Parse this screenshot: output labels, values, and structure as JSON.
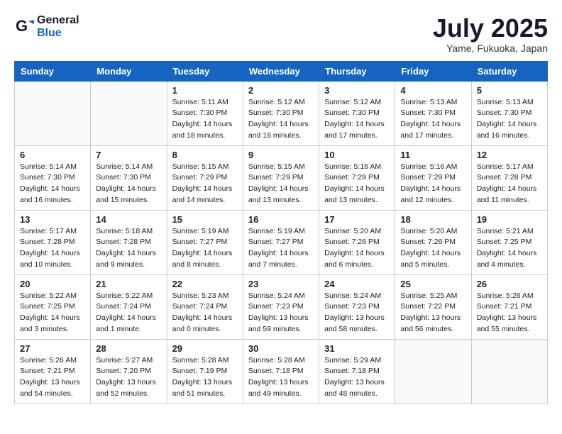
{
  "logo": {
    "general": "General",
    "blue": "Blue"
  },
  "header": {
    "month": "July 2025",
    "location": "Yame, Fukuoka, Japan"
  },
  "weekdays": [
    "Sunday",
    "Monday",
    "Tuesday",
    "Wednesday",
    "Thursday",
    "Friday",
    "Saturday"
  ],
  "weeks": [
    [
      {
        "day": "",
        "empty": true
      },
      {
        "day": "",
        "empty": true
      },
      {
        "day": "1",
        "sunrise": "Sunrise: 5:11 AM",
        "sunset": "Sunset: 7:30 PM",
        "daylight": "Daylight: 14 hours and 18 minutes."
      },
      {
        "day": "2",
        "sunrise": "Sunrise: 5:12 AM",
        "sunset": "Sunset: 7:30 PM",
        "daylight": "Daylight: 14 hours and 18 minutes."
      },
      {
        "day": "3",
        "sunrise": "Sunrise: 5:12 AM",
        "sunset": "Sunset: 7:30 PM",
        "daylight": "Daylight: 14 hours and 17 minutes."
      },
      {
        "day": "4",
        "sunrise": "Sunrise: 5:13 AM",
        "sunset": "Sunset: 7:30 PM",
        "daylight": "Daylight: 14 hours and 17 minutes."
      },
      {
        "day": "5",
        "sunrise": "Sunrise: 5:13 AM",
        "sunset": "Sunset: 7:30 PM",
        "daylight": "Daylight: 14 hours and 16 minutes."
      }
    ],
    [
      {
        "day": "6",
        "sunrise": "Sunrise: 5:14 AM",
        "sunset": "Sunset: 7:30 PM",
        "daylight": "Daylight: 14 hours and 16 minutes."
      },
      {
        "day": "7",
        "sunrise": "Sunrise: 5:14 AM",
        "sunset": "Sunset: 7:30 PM",
        "daylight": "Daylight: 14 hours and 15 minutes."
      },
      {
        "day": "8",
        "sunrise": "Sunrise: 5:15 AM",
        "sunset": "Sunset: 7:29 PM",
        "daylight": "Daylight: 14 hours and 14 minutes."
      },
      {
        "day": "9",
        "sunrise": "Sunrise: 5:15 AM",
        "sunset": "Sunset: 7:29 PM",
        "daylight": "Daylight: 14 hours and 13 minutes."
      },
      {
        "day": "10",
        "sunrise": "Sunrise: 5:16 AM",
        "sunset": "Sunset: 7:29 PM",
        "daylight": "Daylight: 14 hours and 13 minutes."
      },
      {
        "day": "11",
        "sunrise": "Sunrise: 5:16 AM",
        "sunset": "Sunset: 7:29 PM",
        "daylight": "Daylight: 14 hours and 12 minutes."
      },
      {
        "day": "12",
        "sunrise": "Sunrise: 5:17 AM",
        "sunset": "Sunset: 7:28 PM",
        "daylight": "Daylight: 14 hours and 11 minutes."
      }
    ],
    [
      {
        "day": "13",
        "sunrise": "Sunrise: 5:17 AM",
        "sunset": "Sunset: 7:28 PM",
        "daylight": "Daylight: 14 hours and 10 minutes."
      },
      {
        "day": "14",
        "sunrise": "Sunrise: 5:18 AM",
        "sunset": "Sunset: 7:28 PM",
        "daylight": "Daylight: 14 hours and 9 minutes."
      },
      {
        "day": "15",
        "sunrise": "Sunrise: 5:19 AM",
        "sunset": "Sunset: 7:27 PM",
        "daylight": "Daylight: 14 hours and 8 minutes."
      },
      {
        "day": "16",
        "sunrise": "Sunrise: 5:19 AM",
        "sunset": "Sunset: 7:27 PM",
        "daylight": "Daylight: 14 hours and 7 minutes."
      },
      {
        "day": "17",
        "sunrise": "Sunrise: 5:20 AM",
        "sunset": "Sunset: 7:26 PM",
        "daylight": "Daylight: 14 hours and 6 minutes."
      },
      {
        "day": "18",
        "sunrise": "Sunrise: 5:20 AM",
        "sunset": "Sunset: 7:26 PM",
        "daylight": "Daylight: 14 hours and 5 minutes."
      },
      {
        "day": "19",
        "sunrise": "Sunrise: 5:21 AM",
        "sunset": "Sunset: 7:25 PM",
        "daylight": "Daylight: 14 hours and 4 minutes."
      }
    ],
    [
      {
        "day": "20",
        "sunrise": "Sunrise: 5:22 AM",
        "sunset": "Sunset: 7:25 PM",
        "daylight": "Daylight: 14 hours and 3 minutes."
      },
      {
        "day": "21",
        "sunrise": "Sunrise: 5:22 AM",
        "sunset": "Sunset: 7:24 PM",
        "daylight": "Daylight: 14 hours and 1 minute."
      },
      {
        "day": "22",
        "sunrise": "Sunrise: 5:23 AM",
        "sunset": "Sunset: 7:24 PM",
        "daylight": "Daylight: 14 hours and 0 minutes."
      },
      {
        "day": "23",
        "sunrise": "Sunrise: 5:24 AM",
        "sunset": "Sunset: 7:23 PM",
        "daylight": "Daylight: 13 hours and 59 minutes."
      },
      {
        "day": "24",
        "sunrise": "Sunrise: 5:24 AM",
        "sunset": "Sunset: 7:23 PM",
        "daylight": "Daylight: 13 hours and 58 minutes."
      },
      {
        "day": "25",
        "sunrise": "Sunrise: 5:25 AM",
        "sunset": "Sunset: 7:22 PM",
        "daylight": "Daylight: 13 hours and 56 minutes."
      },
      {
        "day": "26",
        "sunrise": "Sunrise: 5:26 AM",
        "sunset": "Sunset: 7:21 PM",
        "daylight": "Daylight: 13 hours and 55 minutes."
      }
    ],
    [
      {
        "day": "27",
        "sunrise": "Sunrise: 5:26 AM",
        "sunset": "Sunset: 7:21 PM",
        "daylight": "Daylight: 13 hours and 54 minutes."
      },
      {
        "day": "28",
        "sunrise": "Sunrise: 5:27 AM",
        "sunset": "Sunset: 7:20 PM",
        "daylight": "Daylight: 13 hours and 52 minutes."
      },
      {
        "day": "29",
        "sunrise": "Sunrise: 5:28 AM",
        "sunset": "Sunset: 7:19 PM",
        "daylight": "Daylight: 13 hours and 51 minutes."
      },
      {
        "day": "30",
        "sunrise": "Sunrise: 5:28 AM",
        "sunset": "Sunset: 7:18 PM",
        "daylight": "Daylight: 13 hours and 49 minutes."
      },
      {
        "day": "31",
        "sunrise": "Sunrise: 5:29 AM",
        "sunset": "Sunset: 7:18 PM",
        "daylight": "Daylight: 13 hours and 48 minutes."
      },
      {
        "day": "",
        "empty": true
      },
      {
        "day": "",
        "empty": true
      }
    ]
  ]
}
